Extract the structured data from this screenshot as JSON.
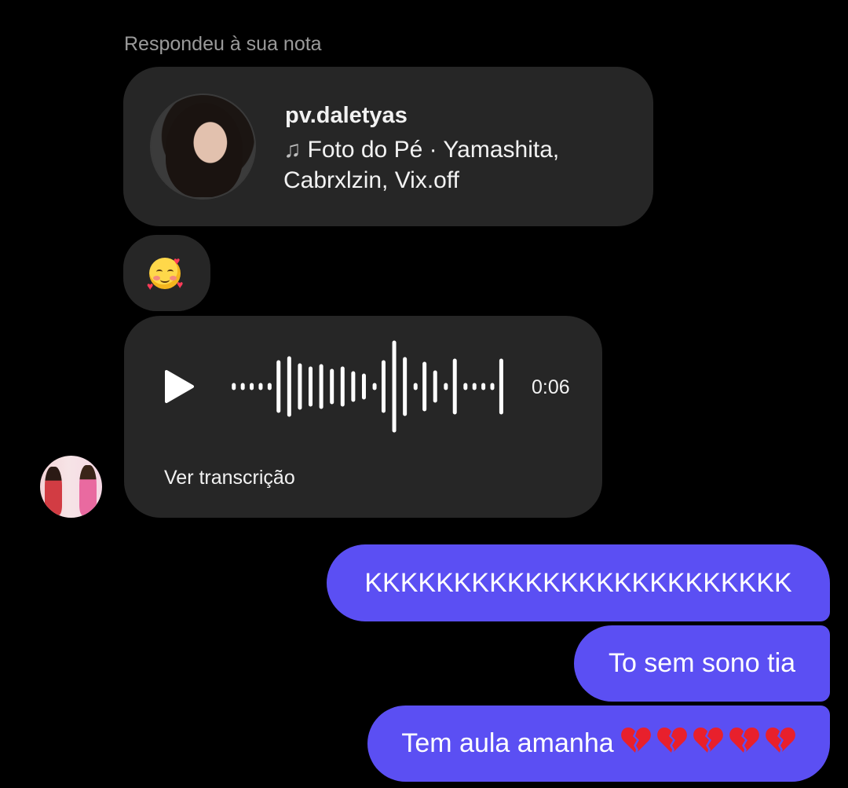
{
  "reply_context": {
    "caption": "Respondeu à sua nota"
  },
  "note": {
    "username": "pv.daletyas",
    "song_icon": "music-note-icon",
    "song_line": "Foto do Pé · Yamashita, Cabrxlzin, Vix.off"
  },
  "reaction_message": {
    "emoji": "smiling-face-with-hearts"
  },
  "voice_message": {
    "play_icon": "play-icon",
    "duration": "0:06",
    "transcript_label": "Ver transcrição"
  },
  "sent_messages": [
    {
      "text": "KKKKKKKKKKKKKKKKKKKKKKKK"
    },
    {
      "text": "To sem sono tia"
    },
    {
      "text": "Tem aula amanha",
      "emoji": "broken-heart",
      "emoji_count": 5
    }
  ],
  "colors": {
    "background": "#000000",
    "incoming_bubble": "#262626",
    "outgoing_bubble": "#5b4ff3",
    "caption_text": "#9a9a9a",
    "heart": "#e8202c"
  }
}
